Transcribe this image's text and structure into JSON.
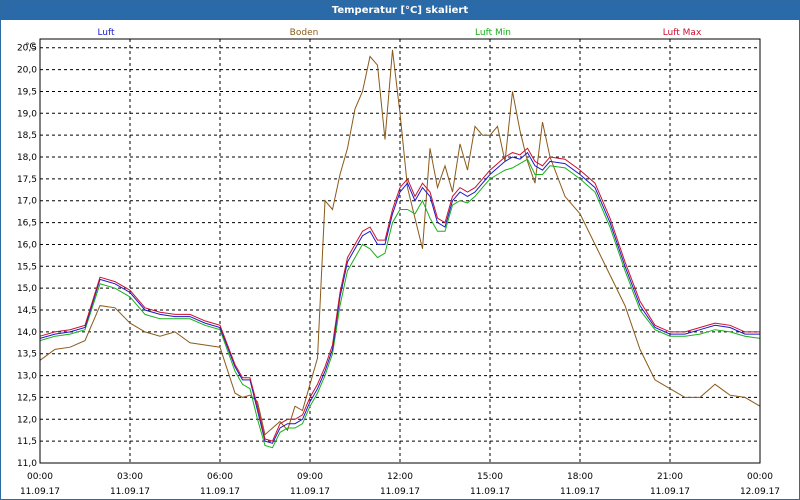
{
  "window": {
    "title": "Temperatur [°C] skaliert"
  },
  "colors": {
    "titlebar": "#2a6aa8",
    "luft": "#1a1acc",
    "boden": "#8b5a1a",
    "luft_min": "#18b018",
    "luft_max": "#cc1030",
    "grid": "#000000"
  },
  "chart_data": {
    "type": "line",
    "title": "Temperatur [°C] skaliert",
    "ylabel": "°C",
    "ylim": [
      11.0,
      20.7
    ],
    "yticks": [
      "11,0",
      "11,5",
      "12,0",
      "12,5",
      "13,0",
      "13,5",
      "14,0",
      "14,5",
      "15,0",
      "15,5",
      "16,0",
      "16,5",
      "17,0",
      "17,5",
      "18,0",
      "18,5",
      "19,0",
      "19,5",
      "20,0",
      "20,5"
    ],
    "xlim": [
      0,
      24
    ],
    "xticks": [
      {
        "time": "00:00",
        "date": "11.09.17"
      },
      {
        "time": "03:00",
        "date": "11.09.17"
      },
      {
        "time": "06:00",
        "date": "11.09.17"
      },
      {
        "time": "09:00",
        "date": "11.09.17"
      },
      {
        "time": "12:00",
        "date": "11.09.17"
      },
      {
        "time": "15:00",
        "date": "11.09.17"
      },
      {
        "time": "18:00",
        "date": "11.09.17"
      },
      {
        "time": "21:00",
        "date": "11.09.17"
      },
      {
        "time": "00:00",
        "date": "12.09.17"
      }
    ],
    "grid": true,
    "legend_position": "top",
    "x": [
      0,
      0.5,
      1,
      1.5,
      2,
      2.5,
      3,
      3.5,
      4,
      4.5,
      5,
      5.5,
      6,
      6.5,
      6.75,
      7,
      7.25,
      7.5,
      7.75,
      8,
      8.25,
      8.5,
      8.75,
      9,
      9.25,
      9.5,
      9.75,
      10,
      10.25,
      10.5,
      10.75,
      11,
      11.25,
      11.5,
      11.75,
      12,
      12.25,
      12.5,
      12.75,
      13,
      13.25,
      13.5,
      13.75,
      14,
      14.25,
      14.5,
      14.75,
      15,
      15.25,
      15.5,
      15.75,
      16,
      16.25,
      16.5,
      16.75,
      17,
      17.5,
      18,
      18.5,
      19,
      19.5,
      20,
      20.5,
      21,
      21.5,
      22,
      22.5,
      23,
      23.5,
      24
    ],
    "series": [
      {
        "name": "Luft",
        "values": [
          13.85,
          13.95,
          14.0,
          14.1,
          15.2,
          15.1,
          14.9,
          14.5,
          14.4,
          14.35,
          14.35,
          14.2,
          14.1,
          13.2,
          12.9,
          12.9,
          12.2,
          11.5,
          11.45,
          11.8,
          11.9,
          11.9,
          12.0,
          12.4,
          12.7,
          13.1,
          13.6,
          14.8,
          15.6,
          15.9,
          16.2,
          16.3,
          16.0,
          16.0,
          16.7,
          17.2,
          17.4,
          17.0,
          17.3,
          17.1,
          16.5,
          16.4,
          17.0,
          17.2,
          17.1,
          17.2,
          17.4,
          17.6,
          17.75,
          17.9,
          18.0,
          17.95,
          18.1,
          17.8,
          17.7,
          17.9,
          17.85,
          17.6,
          17.3,
          16.5,
          15.5,
          14.6,
          14.1,
          13.95,
          13.95,
          14.05,
          14.15,
          14.1,
          13.95,
          13.95
        ]
      },
      {
        "name": "Boden",
        "values": [
          13.35,
          13.6,
          13.65,
          13.8,
          14.6,
          14.55,
          14.2,
          14.0,
          13.9,
          14.0,
          13.75,
          13.7,
          13.65,
          12.6,
          12.5,
          12.55,
          12.4,
          11.65,
          11.8,
          11.95,
          11.75,
          12.3,
          12.2,
          12.8,
          13.4,
          17.0,
          16.8,
          17.6,
          18.2,
          19.1,
          19.5,
          20.3,
          20.1,
          18.4,
          20.45,
          19.0,
          17.3,
          16.6,
          15.9,
          18.2,
          17.3,
          17.8,
          17.2,
          18.3,
          17.7,
          18.7,
          18.5,
          18.5,
          18.7,
          17.9,
          19.5,
          18.6,
          17.9,
          17.4,
          18.8,
          18.0,
          17.1,
          16.7,
          16.0,
          15.3,
          14.6,
          13.6,
          12.9,
          12.7,
          12.5,
          12.5,
          12.8,
          12.55,
          12.5,
          12.3
        ]
      },
      {
        "name": "Luft Min",
        "values": [
          13.8,
          13.9,
          13.95,
          14.05,
          15.1,
          15.0,
          14.8,
          14.4,
          14.3,
          14.3,
          14.3,
          14.15,
          14.05,
          13.1,
          12.8,
          12.7,
          12.0,
          11.4,
          11.35,
          11.7,
          11.8,
          11.8,
          11.9,
          12.3,
          12.6,
          13.0,
          13.5,
          14.6,
          15.4,
          15.7,
          16.0,
          15.9,
          15.7,
          15.8,
          16.5,
          16.8,
          16.8,
          16.7,
          17.0,
          16.6,
          16.3,
          16.3,
          16.9,
          17.0,
          16.95,
          17.1,
          17.3,
          17.5,
          17.6,
          17.7,
          17.75,
          17.85,
          17.95,
          17.6,
          17.6,
          17.8,
          17.75,
          17.5,
          17.2,
          16.4,
          15.4,
          14.5,
          14.05,
          13.9,
          13.9,
          13.95,
          14.05,
          14.0,
          13.9,
          13.85
        ]
      },
      {
        "name": "Luft Max",
        "values": [
          13.9,
          14.0,
          14.05,
          14.15,
          15.25,
          15.15,
          14.95,
          14.55,
          14.45,
          14.4,
          14.4,
          14.25,
          14.15,
          13.25,
          12.95,
          12.95,
          12.3,
          11.55,
          11.5,
          11.9,
          12.0,
          12.0,
          12.1,
          12.5,
          12.8,
          13.2,
          13.7,
          14.9,
          15.7,
          16.0,
          16.3,
          16.4,
          16.1,
          16.1,
          16.8,
          17.3,
          17.5,
          17.1,
          17.4,
          17.2,
          16.6,
          16.5,
          17.1,
          17.3,
          17.2,
          17.3,
          17.5,
          17.7,
          17.85,
          18.0,
          18.1,
          18.05,
          18.2,
          17.9,
          17.8,
          18.0,
          17.95,
          17.7,
          17.4,
          16.6,
          15.6,
          14.7,
          14.15,
          14.0,
          14.0,
          14.1,
          14.2,
          14.15,
          14.0,
          14.0
        ]
      }
    ]
  }
}
